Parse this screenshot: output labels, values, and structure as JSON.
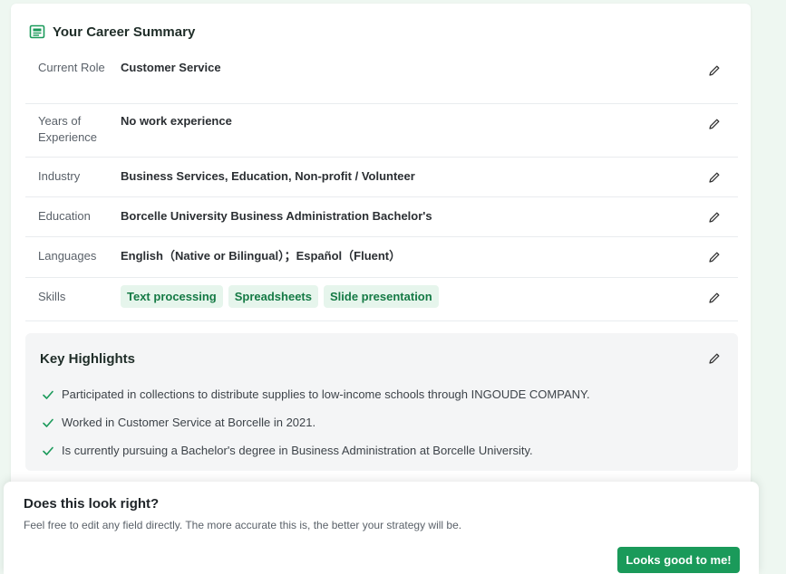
{
  "summary": {
    "title": "Your Career Summary",
    "rows": [
      {
        "label": "Current Role",
        "value": "Customer Service"
      },
      {
        "label": "Years of Experience",
        "value": "No work experience"
      },
      {
        "label": "Industry",
        "value": "Business Services, Education, Non-profit / Volunteer"
      },
      {
        "label": "Education",
        "value": "Borcelle University Business Administration Bachelor's"
      },
      {
        "label": "Languages",
        "value": "English（Native or Bilingual）；Español（Fluent）"
      },
      {
        "label": "Skills",
        "chips": [
          "Text processing",
          "Spreadsheets",
          "Slide presentation"
        ]
      }
    ]
  },
  "highlights": {
    "title": "Key Highlights",
    "items": [
      "Participated in collections to distribute supplies to low-income schools through INGOUDE COMPANY.",
      "Worked in Customer Service at Borcelle in 2021.",
      "Is currently pursuing a Bachelor's degree in Business Administration at Borcelle University."
    ]
  },
  "confirm": {
    "title": "Does this look right?",
    "subtitle": "Feel free to edit any field directly. The more accurate this is, the better your strategy will be.",
    "button_label": "Looks good to me!"
  },
  "colors": {
    "accent": "#1a9a5a",
    "chip_bg": "#e6f5ec",
    "chip_text": "#157a45",
    "page_bg": "#eef7f1"
  },
  "icons": {
    "header": "resume-icon",
    "edit": "pencil-icon",
    "check": "check-icon"
  }
}
